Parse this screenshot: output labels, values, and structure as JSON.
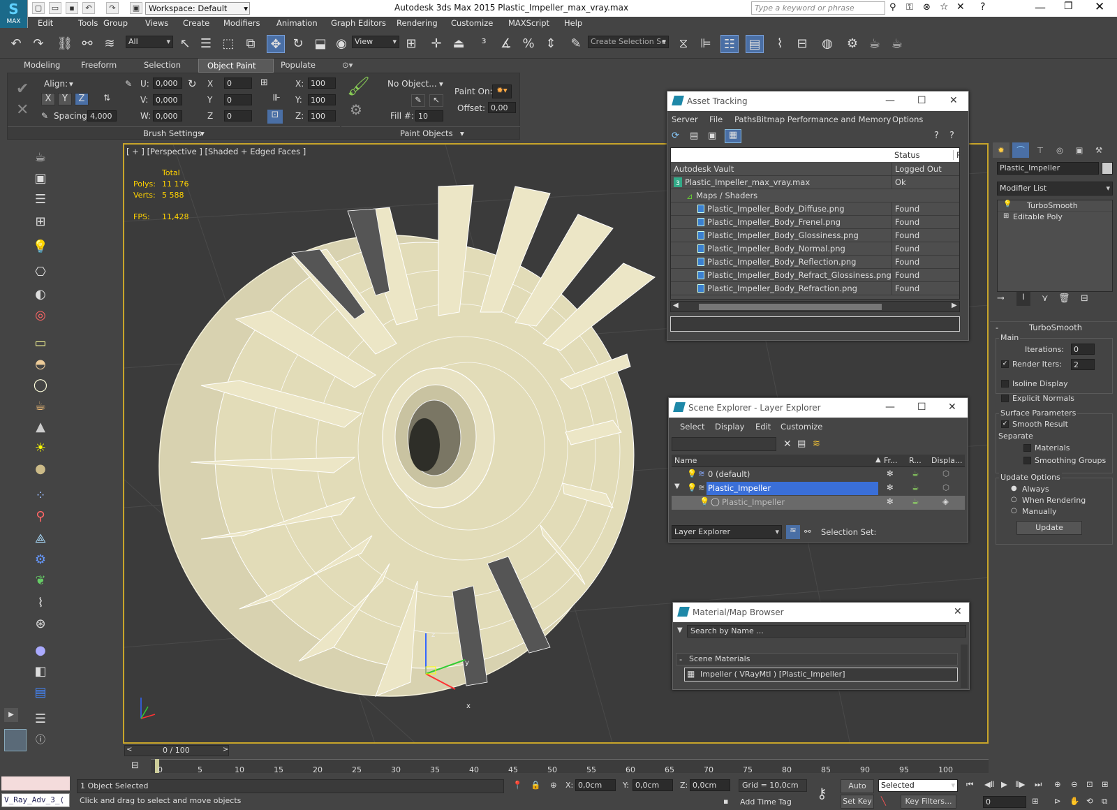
{
  "app": {
    "title": "Autodesk 3ds Max  2015     Plastic_Impeller_max_vray.max",
    "workspace": "Workspace: Default",
    "search_placeholder": "Type a keyword or phrase",
    "logo_text": "MAX"
  },
  "menu": [
    "Edit",
    "Tools",
    "Group",
    "Views",
    "Create",
    "Modifiers",
    "Animation",
    "Graph Editors",
    "Rendering",
    "Customize",
    "MAXScript",
    "Help"
  ],
  "toolbar": {
    "filter": "All",
    "ref_coord": "View",
    "selection_set_placeholder": "Create Selection Se"
  },
  "ribbon": {
    "tabs": [
      "Modeling",
      "Freeform",
      "Selection",
      "Object Paint",
      "Populate"
    ],
    "active_tab": "Object Paint",
    "align_label": "Align:",
    "axes": [
      "X",
      "Y",
      "Z"
    ],
    "spacing_label": "Spacing:",
    "spacing_value": "4,000",
    "u_label": "U:",
    "u_value": "0,000",
    "v_label": "V:",
    "v_value": "0,000",
    "w_label": "W:",
    "w_value": "0,000",
    "x_label": "X",
    "x_value": "0",
    "y_label": "Y",
    "y_value": "0",
    "z_label": "Z",
    "z_value": "0",
    "sx_label": "X:",
    "sx_value": "100",
    "sy_label": "Y:",
    "sy_value": "100",
    "sz_label": "Z:",
    "sz_value": "100",
    "brush_settings": "Brush Settings",
    "no_object": "No Object...",
    "fill_label": "Fill #:",
    "fill_value": "10",
    "paint_on": "Paint On:",
    "offset_label": "Offset:",
    "offset_value": "0,00",
    "paint_objects": "Paint Objects"
  },
  "viewport": {
    "label": "[ + ] [Perspective ] [Shaded + Edged Faces ]",
    "total": "Total",
    "polys_label": "Polys:",
    "polys_value": "11 176",
    "verts_label": "Verts:",
    "verts_value": "5 588",
    "fps_label": "FPS:",
    "fps_value": "11,428",
    "gizmo_x": "x",
    "gizmo_y": "y",
    "gizmo_z": "z"
  },
  "asset_tracking": {
    "title": "Asset Tracking",
    "menu": [
      "Server",
      "File",
      "Paths",
      "Bitmap Performance and Memory",
      "Options"
    ],
    "col_status": "Status",
    "col_pro": "Pro",
    "rows": [
      {
        "name": "Autodesk Vault",
        "status": "Logged Out ..."
      },
      {
        "name": "Plastic_Impeller_max_vray.max",
        "status": "Ok"
      },
      {
        "name": "Maps / Shaders",
        "status": ""
      },
      {
        "name": "Plastic_Impeller_Body_Diffuse.png",
        "status": "Found"
      },
      {
        "name": "Plastic_Impeller_Body_Frenel.png",
        "status": "Found"
      },
      {
        "name": "Plastic_Impeller_Body_Glossiness.png",
        "status": "Found"
      },
      {
        "name": "Plastic_Impeller_Body_Normal.png",
        "status": "Found"
      },
      {
        "name": "Plastic_Impeller_Body_Reflection.png",
        "status": "Found"
      },
      {
        "name": "Plastic_Impeller_Body_Refract_Glossiness.png",
        "status": "Found"
      },
      {
        "name": "Plastic_Impeller_Body_Refraction.png",
        "status": "Found"
      }
    ]
  },
  "scene_explorer": {
    "title": "Scene Explorer - Layer Explorer",
    "menu": [
      "Select",
      "Display",
      "Edit",
      "Customize"
    ],
    "col_name": "Name",
    "col_fr": "Fr...",
    "col_r": "R...",
    "col_disp": "Displa...",
    "rows": [
      "0 (default)",
      "Plastic_Impeller",
      "Plastic_Impeller"
    ],
    "footer_mode": "Layer Explorer",
    "selection_set": "Selection Set:"
  },
  "material_browser": {
    "title": "Material/Map Browser",
    "search_placeholder": "Search by Name ...",
    "group": "Scene Materials",
    "item": "Impeller  ( VRayMtl ) [Plastic_Impeller]"
  },
  "command_panel": {
    "object_name": "Plastic_Impeller",
    "modifier_list": "Modifier List",
    "stack": [
      "TurboSmooth",
      "Editable Poly"
    ],
    "rollout": "TurboSmooth",
    "main": "Main",
    "iterations_label": "Iterations:",
    "iterations_value": "0",
    "render_iters_label": "Render Iters:",
    "render_iters_value": "2",
    "isoline": "Isoline Display",
    "explicit_normals": "Explicit Normals",
    "surface_params": "Surface Parameters",
    "smooth_result": "Smooth Result",
    "separate": "Separate",
    "materials": "Materials",
    "smoothing_groups": "Smoothing Groups",
    "update_options": "Update Options",
    "always": "Always",
    "when_rendering": "When Rendering",
    "manually": "Manually",
    "update": "Update"
  },
  "timeline": {
    "frame": "0 / 100",
    "ticks": [
      "0",
      "5",
      "10",
      "15",
      "20",
      "25",
      "30",
      "35",
      "40",
      "45",
      "50",
      "55",
      "60",
      "65",
      "70",
      "75",
      "80",
      "85",
      "90",
      "95",
      "100"
    ]
  },
  "status": {
    "script_listener": "V_Ray_Adv_3_(",
    "selected": "1 Object Selected",
    "prompt": "Click and drag to select and move objects",
    "x_label": "X:",
    "x_value": "0,0cm",
    "y_label": "Y:",
    "y_value": "0,0cm",
    "z_label": "Z:",
    "z_value": "0,0cm",
    "grid": "Grid = 10,0cm",
    "add_time_tag": "Add Time Tag",
    "auto_key": "Auto Key",
    "set_key": "Set Key",
    "selected_mode": "Selected",
    "key_filters": "Key Filters...",
    "frame_value": "0"
  }
}
